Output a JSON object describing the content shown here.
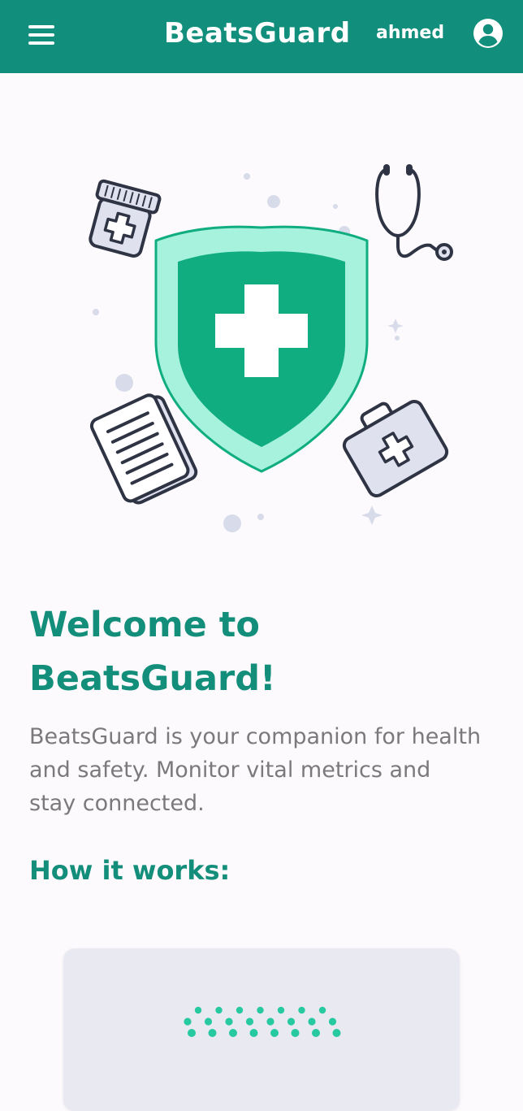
{
  "header": {
    "app_title": "BeatsGuard",
    "username": "ahmed",
    "menu_icon": "hamburger-menu-icon",
    "profile_icon": "account-circle-icon"
  },
  "hero": {
    "illustration": "health-shield-illustration",
    "icons": [
      "medicine-bottle-icon",
      "stethoscope-icon",
      "shield-cross-icon",
      "clipboard-icon",
      "first-aid-kit-icon"
    ]
  },
  "main": {
    "welcome_title": "Welcome to BeatsGuard!",
    "intro_text": "BeatsGuard is your companion for health and safety. Monitor vital metrics and stay connected.",
    "how_it_works_title": "How it works:"
  },
  "card": {
    "illustration": "dots-pattern-illustration"
  },
  "colors": {
    "primary": "#128e7c",
    "heading": "#138e7b",
    "body_text": "#7a7a7a",
    "background": "#fdfafd",
    "shield_fill": "#10ad80",
    "shield_outline": "#a6f2dd",
    "card_background": "#e9e9f2",
    "dot_accent": "#27c9a0"
  }
}
